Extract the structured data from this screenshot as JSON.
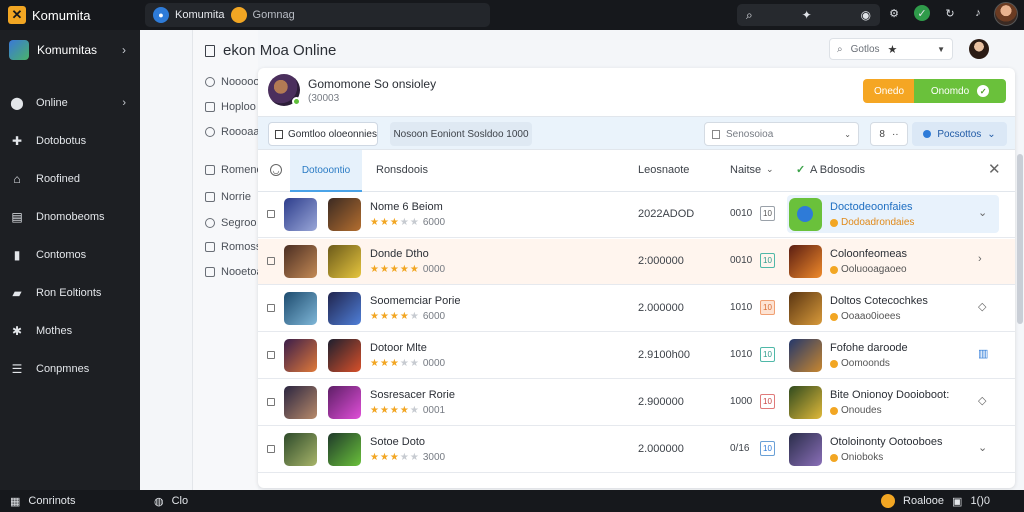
{
  "app": {
    "title": "Komumita"
  },
  "topbar": {
    "tabs": [
      {
        "label": "Komumita",
        "icon": "globe-icon",
        "color": "#2e7bd8"
      },
      {
        "label": "Gomnag",
        "icon": "orange-dot-icon",
        "color": "#f2a623"
      }
    ],
    "search_icon": "search-icon",
    "icons": [
      "settings-icon",
      "shield-icon",
      "sync-icon",
      "bell-icon"
    ]
  },
  "sidebar": {
    "workspace": "Komumitas",
    "items": [
      {
        "label": "Online",
        "icon": "location-icon",
        "chevron": true
      },
      {
        "label": "Dotobotus",
        "icon": "puzzle-icon"
      },
      {
        "label": "Roofined",
        "icon": "home-icon"
      },
      {
        "label": "Dnomobeoms",
        "icon": "chart-icon"
      },
      {
        "label": "Contomos",
        "icon": "bookmark-icon"
      },
      {
        "label": "Ron Eoltionts",
        "icon": "car-icon"
      },
      {
        "label": "Mothes",
        "icon": "gear-icon"
      },
      {
        "label": "Conpmnes",
        "icon": "table-icon"
      }
    ]
  },
  "statusbar": {
    "left": "Conrinots",
    "mid": "Clo",
    "right_label": "Roalooe",
    "right_count": "1()0"
  },
  "main": {
    "title": "ekon Moa Online",
    "search_value": "Gotlos",
    "left_items": [
      {
        "label": "Nooooo"
      },
      {
        "label": "Hoploo"
      },
      {
        "label": "Roooaa"
      },
      {
        "label": "Romeno"
      },
      {
        "label": "Norrie"
      },
      {
        "label": "Segroo"
      },
      {
        "label": "Romoss"
      },
      {
        "label": "Nooetoa"
      }
    ]
  },
  "card": {
    "title": "Gomomone So onsioley",
    "subtitle": "(30003",
    "btn_orange": "Onedo",
    "btn_green": "Onomdo",
    "filters": {
      "active_tab": "Gomtloo oloeonnies",
      "tab2": "Nosoon Eoniont Sosldoo 1000",
      "select_placeholder": "Senosoioa",
      "mini": "8",
      "button": "Pocsottos"
    },
    "table_head": {
      "active_tab": "Dotooontio",
      "col1": "Ronsdoois",
      "col2": "Leosnaote",
      "col3": "Naitse",
      "col4": "A Bdosodis"
    },
    "rows": [
      {
        "name": "Nome 6 Beiom",
        "stars": 3,
        "count": "6000",
        "value": "2022ADOD",
        "code": "0010",
        "chip": "10",
        "chip_style": "grey",
        "rname": "Doctodeoonfaies",
        "rsub": "Dodoadrondaies",
        "feat": true,
        "action": "chevron-down-icon",
        "hl": false,
        "h1": "linear-gradient(135deg,#2d3d8c,#9aa7d8)",
        "h2": "linear-gradient(135deg,#3b2a22,#b46e2f)",
        "h3": ""
      },
      {
        "name": "Donde Dtho",
        "stars": 5,
        "count": "0000",
        "value": "2:000000",
        "code": "0010",
        "chip": "10",
        "chip_style": "teal",
        "rname": "Coloonfeomeas",
        "rsub": "Ooluooagaoeo",
        "feat": false,
        "action": "chevron-right-icon",
        "hl": true,
        "h1": "linear-gradient(135deg,#4a2d22,#c48a55)",
        "h2": "linear-gradient(135deg,#6b5a1a,#e6c53e)",
        "h3": "linear-gradient(135deg,#5a1d12,#f08a2a)"
      },
      {
        "name": "Soomemciar Porie",
        "stars": 4,
        "count": "6000",
        "value": "2.000000",
        "code": "1010",
        "chip": "10",
        "chip_style": "orange",
        "rname": "Doltos Cotecochkes",
        "rsub": "Ooaao0ioees",
        "feat": false,
        "action": "diamond-icon",
        "hl": false,
        "h1": "linear-gradient(135deg,#1d4b6e,#7fb7d8)",
        "h2": "linear-gradient(135deg,#20244d,#4f7fd8)",
        "h3": "linear-gradient(135deg,#5a3512,#d89a3a)"
      },
      {
        "name": "Dotoor Mlte",
        "stars": 3,
        "count": "0000",
        "value": "2.9100h00",
        "code": "1010",
        "chip": "10",
        "chip_style": "teal",
        "rname": "Fofohe daroode",
        "rsub": "Oomoonds",
        "feat": false,
        "action": "bookmark-icon",
        "hl": false,
        "h1": "linear-gradient(135deg,#3a1d4a,#e07a3a)",
        "h2": "linear-gradient(135deg,#1d1f2e,#d8502a)",
        "h3": "linear-gradient(135deg,#23376b,#c8872f)"
      },
      {
        "name": "Sosresacer Rorie",
        "stars": 4,
        "count": "0001",
        "value": "2.900000",
        "code": "1000",
        "chip": "10",
        "chip_style": "red",
        "rname": "Bite Onionoy Dooioboot:",
        "rsub": "Onoudes",
        "feat": false,
        "action": "diamond-icon",
        "hl": false,
        "h1": "linear-gradient(135deg,#2a2540,#b88a6a)",
        "h2": "linear-gradient(135deg,#5d1e66,#e04fd8)",
        "h3": "linear-gradient(135deg,#2f4a1e,#e0b93a)"
      },
      {
        "name": "Sotoe Doto",
        "stars": 3,
        "count": "3000",
        "value": "2.000000",
        "code": "0/16",
        "chip": "10",
        "chip_style": "blue",
        "rname": "Otoloinonty Ootooboes",
        "rsub": "Onioboks",
        "feat": false,
        "action": "chevron-down-icon",
        "hl": false,
        "h1": "linear-gradient(135deg,#2d4a2a,#a8b56a)",
        "h2": "linear-gradient(135deg,#1f3a2a,#6ac13b)",
        "h3": "linear-gradient(135deg,#2a2d4a,#8a6fb8)"
      }
    ]
  },
  "colors": {
    "accent": "#2e7bd8",
    "orange": "#f5a623",
    "green": "#6ac13b"
  }
}
